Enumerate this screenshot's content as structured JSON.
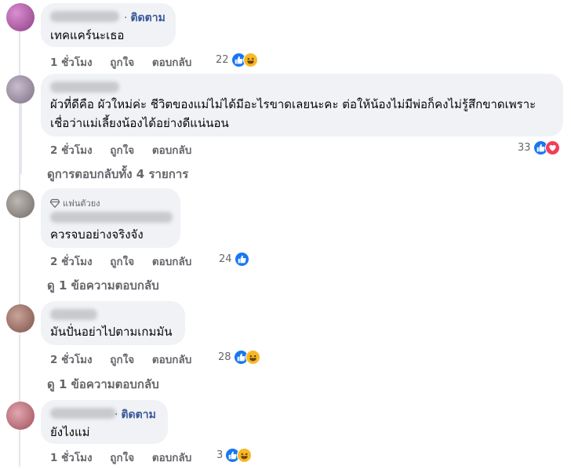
{
  "comments": [
    {
      "follow": "ติดตาม",
      "text": "เทคแคร์นะเธอ",
      "time": "1 ชั่วโมง",
      "like": "ถูกใจ",
      "reply": "ตอบกลับ",
      "reaction_count": "22",
      "reaction_icons": [
        "like-icon",
        "haha-icon"
      ],
      "avatar_color": "#b15ca8"
    },
    {
      "text_lines": [
        "ผัวที่ดีคือ ผัวใหม่ค่ะ ชีวิตของแม่ไม่ได้มีอะไรขาดเลยนะคะ ต่อให้น้องไม่มีพ่อก็คงไม่รู้สึกขาดเพราะ",
        "เชื่อว่าแม่เลี้ยงน้องได้อย่างดีแน่นอน"
      ],
      "time": "2 ชั่วโมง",
      "like": "ถูกใจ",
      "reply": "ตอบกลับ",
      "reaction_count": "33",
      "reaction_icons": [
        "like-icon",
        "love-icon"
      ],
      "view_replies": "ดูการตอบกลับทั้ง 4 รายการ",
      "avatar_color": "#9e8fa8"
    },
    {
      "badge": "แฟนตัวยง",
      "text": "ควรจบอย่างจริงจัง",
      "time": "2 ชั่วโมง",
      "like": "ถูกใจ",
      "reply": "ตอบกลับ",
      "reaction_count": "24",
      "reaction_icons": [
        "like-icon"
      ],
      "view_replies": "ดู 1 ข้อความตอบกลับ",
      "avatar_color": "#8f8a86"
    },
    {
      "text": "มันปั่นอย่าไปตามเกมมัน",
      "time": "2 ชั่วโมง",
      "like": "ถูกใจ",
      "reply": "ตอบกลับ",
      "reaction_count": "28",
      "reaction_icons": [
        "like-icon",
        "haha-icon"
      ],
      "view_replies": "ดู 1 ข้อความตอบกลับ",
      "avatar_color": "#a0756b"
    },
    {
      "follow": "ติดตาม",
      "text": "ยังไงแม่",
      "time": "1 ชั่วโมง",
      "like": "ถูกใจ",
      "reply": "ตอบกลับ",
      "reaction_count": "3",
      "reaction_icons": [
        "like-icon",
        "haha-icon"
      ],
      "avatar_color": "#c07a84"
    }
  ],
  "colors": {
    "bubble": "#f0f2f5",
    "meta_text": "#65676b",
    "follow_link": "#385898",
    "like": "#1877f2",
    "haha": "#f7b928",
    "love": "#f33e58"
  }
}
